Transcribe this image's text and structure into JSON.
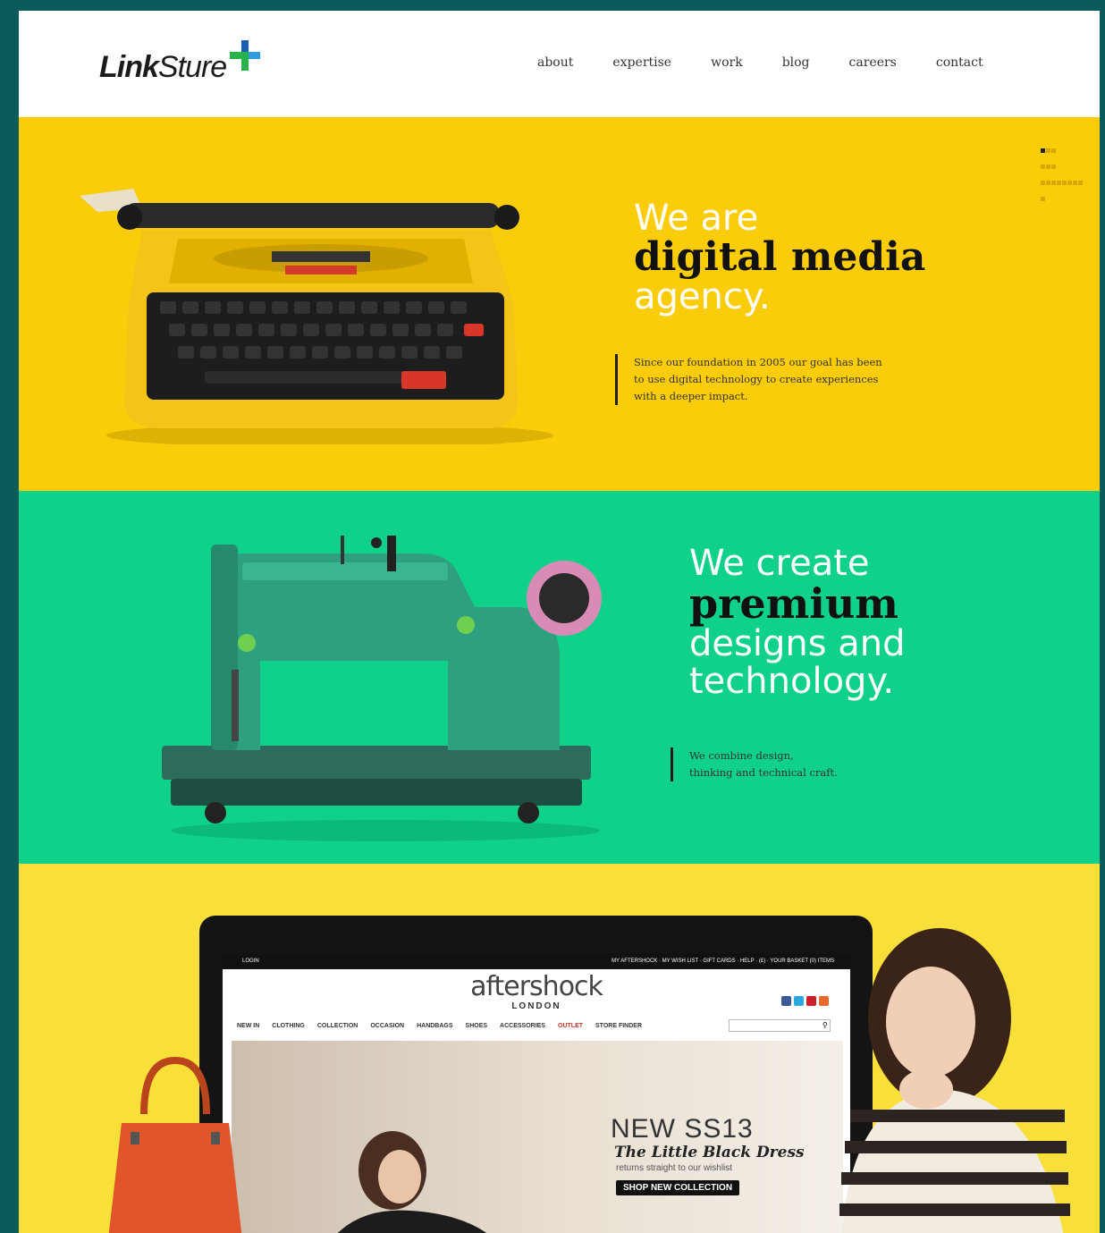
{
  "header": {
    "logo_link": "Link",
    "logo_sture": "Sture",
    "nav": [
      "about",
      "expertise",
      "work",
      "blog",
      "careers",
      "contact"
    ]
  },
  "slides": [
    {
      "pre": "We are",
      "bold": "digital media",
      "post": "agency.",
      "blurb": [
        "Since our foundation in 2005 our goal has been",
        "to use digital technology to create experiences",
        "with a deeper impact."
      ]
    },
    {
      "pre": "We create",
      "bold": "premium",
      "post1": "designs and",
      "post2": "technology.",
      "blurb": [
        "We combine design,",
        "thinking and technical craft."
      ]
    }
  ],
  "mockup": {
    "login": "LOGIN",
    "topbar_right": "MY AFTERSHOCK  ·  MY WISH LIST  ·  GIFT CARDS  ·  HELP  ·  (£)  ·  YOUR BASKET (0) ITEMS",
    "brand": "aftershock",
    "brand_sub": "LONDON",
    "subnav": [
      "NEW IN",
      "CLOTHING",
      "COLLECTION",
      "OCCASION",
      "HANDBAGS",
      "SHOES",
      "ACCESSORIES",
      "OUTLET",
      "STORE FINDER"
    ],
    "banner_title": "NEW SS13",
    "banner_sub": "The Little Black Dress",
    "banner_small": "returns straight to our wishlist",
    "banner_btn": "SHOP NEW COLLECTION"
  },
  "colors": {
    "slide1_bg": "#fbcc0a",
    "slide2_bg": "#0fd189",
    "slide3_bg": "#f9df3a",
    "frame_bg": "#0b5a5c"
  }
}
